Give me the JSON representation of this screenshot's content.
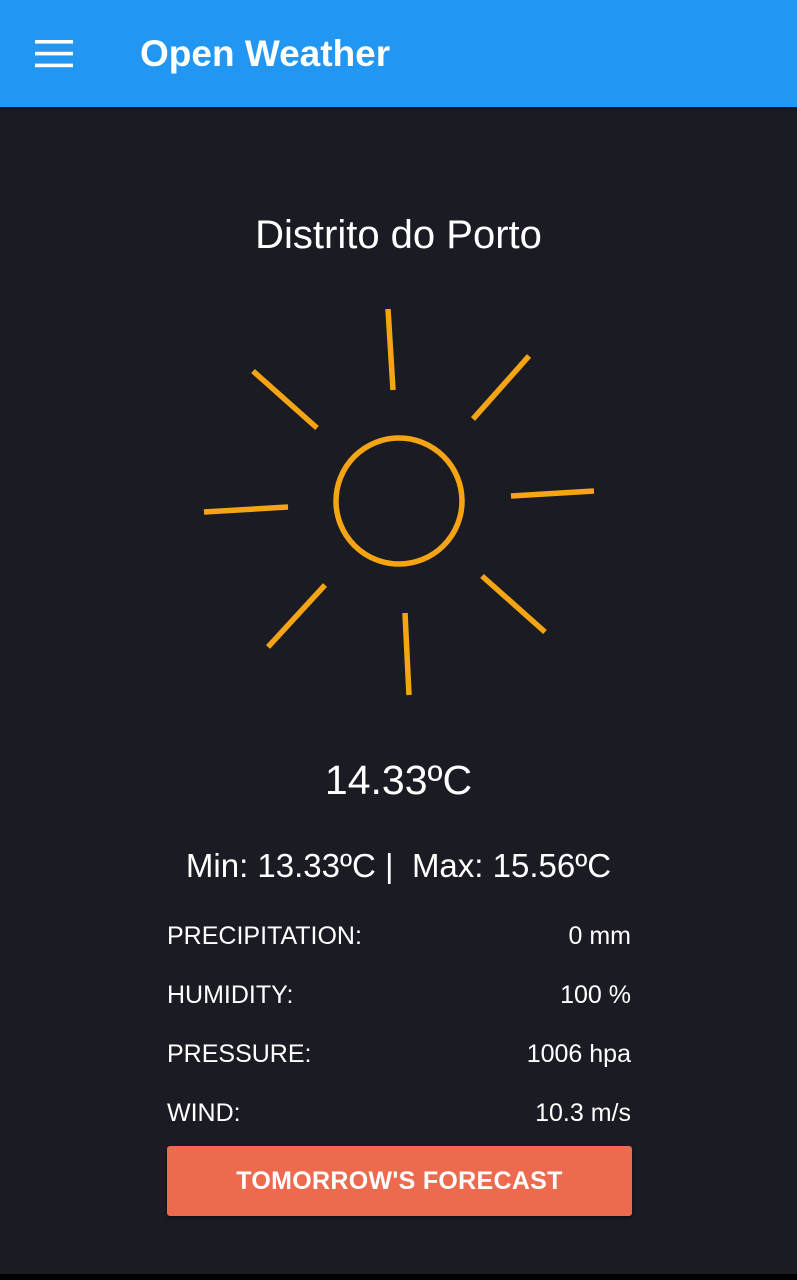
{
  "app_bar": {
    "title": "Open Weather",
    "menu_icon": "hamburger-menu-icon",
    "background_color": "#2196f3"
  },
  "weather": {
    "city": "Distrito do Porto",
    "icon": "sun-icon",
    "icon_color": "#f5a513",
    "temperature": "14.33ºC",
    "min_max": "Min: 13.33ºC |  Max: 15.56ºC",
    "details": [
      {
        "label": "PRECIPITATION:",
        "value": "0 mm"
      },
      {
        "label": "HUMIDITY:",
        "value": "100 %"
      },
      {
        "label": "PRESSURE:",
        "value": "1006 hpa"
      },
      {
        "label": "WIND:",
        "value": "10.3 m/s"
      }
    ]
  },
  "forecast_button": {
    "label": "TOMORROW'S FORECAST",
    "color": "#ee6a4f"
  },
  "background_color": "#1b1b24"
}
